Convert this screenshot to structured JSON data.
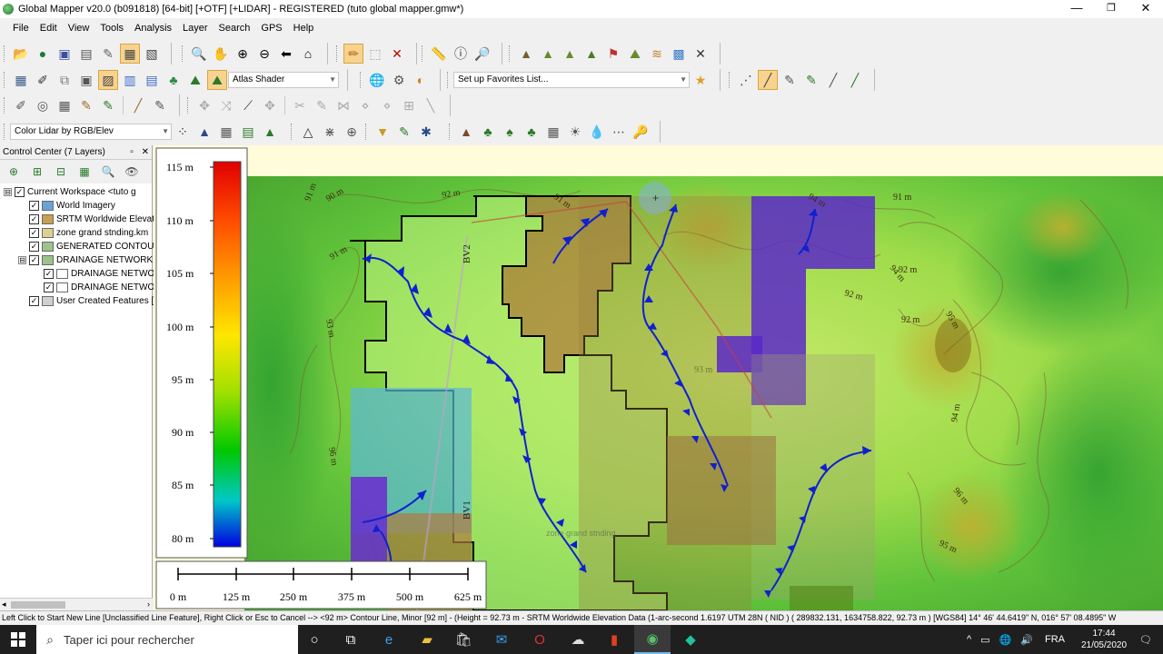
{
  "window": {
    "title": "Global Mapper v20.0 (b091818) [64-bit] [+OTF] [+LIDAR] - REGISTERED (tuto global mapper.gmw*)",
    "minimize": "—",
    "maximize": "❐",
    "close": "✕"
  },
  "menu": [
    "File",
    "Edit",
    "View",
    "Tools",
    "Analysis",
    "Layer",
    "Search",
    "GPS",
    "Help"
  ],
  "toolbars": {
    "shader_combo": "Atlas Shader",
    "favorites_combo": "Set up Favorites List...",
    "lidar_color_combo": "Color Lidar by RGB/Elev"
  },
  "control_center": {
    "title": "Control Center (7 Layers)",
    "pin": "▫",
    "close": "✕",
    "layers": [
      {
        "label": "Current Workspace <tuto g",
        "level": 0,
        "expander": "⊟",
        "checked": true
      },
      {
        "label": "World Imagery",
        "level": 1,
        "checked": true,
        "icon_color": "#6aa3d8"
      },
      {
        "label": "SRTM Worldwide Elevat",
        "level": 1,
        "checked": true,
        "icon_color": "#c8a050"
      },
      {
        "label": "zone grand stnding.km",
        "level": 1,
        "checked": true,
        "icon_color": "#e0d090"
      },
      {
        "label": "GENERATED CONTOUR",
        "level": 1,
        "checked": true,
        "icon_color": "#9ac48a"
      },
      {
        "label": "DRAINAGE NETWORK",
        "level": 1,
        "expander": "⊟",
        "checked": true,
        "icon_color": "#9ac48a"
      },
      {
        "label": "DRAINAGE NETWOR",
        "level": 2,
        "checked": true,
        "icon_color": "#ffffff"
      },
      {
        "label": "DRAINAGE NETWOR",
        "level": 2,
        "checked": true,
        "icon_color": "#ffffff"
      },
      {
        "label": "User Created Features [",
        "level": 1,
        "checked": true,
        "icon_color": "#d0d0d0"
      }
    ]
  },
  "legend": {
    "elevation_labels": [
      "115 m",
      "110 m",
      "105 m",
      "100 m",
      "95 m",
      "90 m",
      "85 m",
      "80 m"
    ],
    "scale_labels": [
      "0 m",
      "125 m",
      "250 m",
      "375 m",
      "500 m",
      "625 m"
    ]
  },
  "map": {
    "contour_labels": [
      "90 m",
      "92 m",
      "91 m",
      "91 m",
      "91 m",
      "91 m",
      "92 m",
      "94 m",
      "92 m",
      "95 m",
      "92 m",
      "93 m",
      "96 m",
      "95 m",
      "94 m",
      "96 m",
      "94 m",
      "93 m"
    ],
    "subbasin_labels": [
      "BV2",
      "BV1"
    ],
    "zone_label": "zone grand stnding"
  },
  "status_bar": "Left Click to Start New Line [Unclassified Line Feature], Right Click or Esc to Cancel --> <92 m> Contour Line, Minor [92 m] - (Height = 92.73 m - SRTM Worldwide Elevation Data (1-arc-second 1.6197 UTM 28N ( NID ) ( 289832.131, 1634758.822, 92.73 m ) [WGS84] 14° 46' 44.6419\" N, 016° 57' 08.4895\" W",
  "taskbar": {
    "search_placeholder": "Taper ici pour rechercher",
    "language": "FRA",
    "time": "17:44",
    "date": "21/05/2020"
  }
}
